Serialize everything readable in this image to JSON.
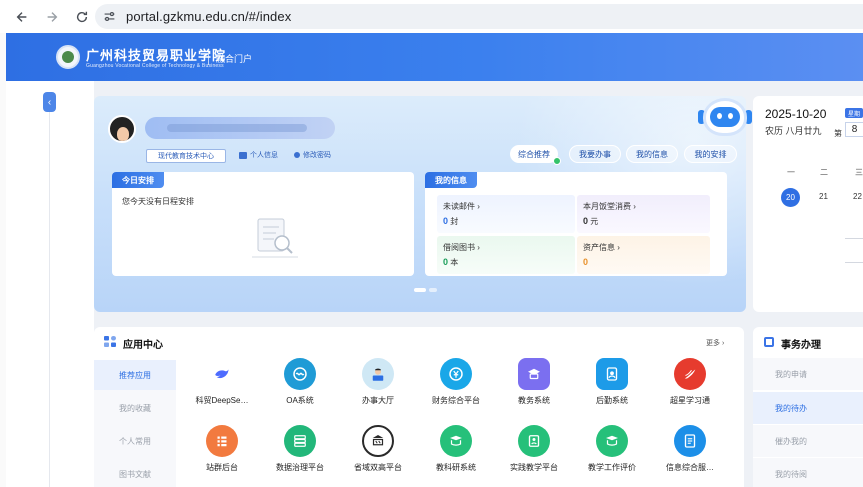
{
  "browser": {
    "url": "portal.gzkmu.edu.cn/#/index"
  },
  "header": {
    "school_name": "广州科技贸易职业学院",
    "school_name_en": "Guangzhou Vocational College of Technology & Business",
    "portal_name": "融合门户"
  },
  "profile": {
    "dept": "现代教育技术中心",
    "personal_info": "个人信息",
    "change_password": "修改密码",
    "tabs": [
      "综合推荐",
      "我要办事",
      "我的信息",
      "我的安排"
    ]
  },
  "today": {
    "title": "今日安排",
    "empty_text": "您今天没有日程安排"
  },
  "myinfo": {
    "title": "我的信息",
    "items": [
      {
        "label": "未读邮件",
        "value": "0",
        "unit": "封"
      },
      {
        "label": "本月饭堂消费",
        "value": "0",
        "unit": "元"
      },
      {
        "label": "借阅图书",
        "value": "0",
        "unit": "本"
      },
      {
        "label": "资产信息",
        "value": "0",
        "unit": ""
      }
    ]
  },
  "calendar": {
    "date": "2025-10-20",
    "lunar": "农历 八月廿九",
    "week_badge": "星期",
    "week_prefix": "第",
    "week_num": "8",
    "headers": [
      "一",
      "二",
      "三"
    ],
    "days": [
      "20",
      "21",
      "22"
    ]
  },
  "apps": {
    "title": "应用中心",
    "more": "更多",
    "side": [
      "推荐应用",
      "我的收藏",
      "个人常用",
      "图书文献"
    ],
    "items": [
      {
        "label": "科贸DeepSe…",
        "color": "#ffffff",
        "icon": "whale-icon"
      },
      {
        "label": "OA系统",
        "color": "#1f9bd6",
        "icon": "oa-icon"
      },
      {
        "label": "办事大厅",
        "color": "#cfe8f5",
        "icon": "service-hall-icon"
      },
      {
        "label": "财务综合平台",
        "color": "#1aa7e8",
        "icon": "finance-icon"
      },
      {
        "label": "教务系统",
        "color": "#7b6ff0",
        "icon": "academic-icon"
      },
      {
        "label": "后勤系统",
        "color": "#1d9be8",
        "icon": "logistics-icon"
      },
      {
        "label": "超星学习通",
        "color": "#e63b2e",
        "icon": "chaoxing-icon"
      },
      {
        "label": "站群后台",
        "color": "#f27a3f",
        "icon": "site-group-icon"
      },
      {
        "label": "数据治理平台",
        "color": "#22b77a",
        "icon": "data-gov-icon"
      },
      {
        "label": "省域双高平台",
        "color": "#2a2a2a",
        "icon": "double-high-icon"
      },
      {
        "label": "教科研系统",
        "color": "#26c07a",
        "icon": "research-icon"
      },
      {
        "label": "实践教学平台",
        "color": "#26c07a",
        "icon": "practice-icon"
      },
      {
        "label": "教学工作评价",
        "color": "#26c07a",
        "icon": "evaluation-icon"
      },
      {
        "label": "信息综合服…",
        "color": "#1c8fe8",
        "icon": "info-service-icon"
      }
    ]
  },
  "tasks": {
    "title": "事务办理",
    "items": [
      "我的申请",
      "我的待办",
      "催办我的",
      "我的待阅"
    ]
  }
}
